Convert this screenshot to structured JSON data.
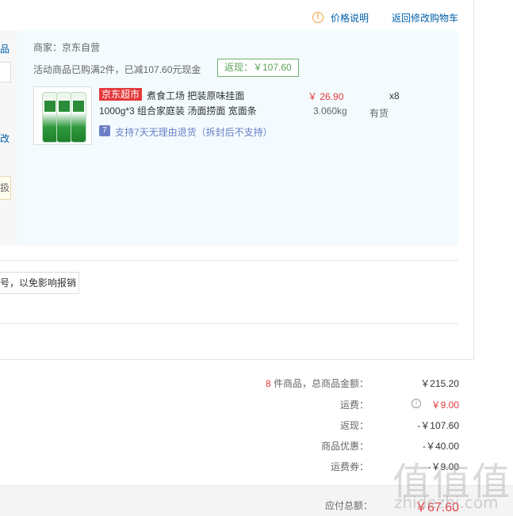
{
  "header": {
    "price_explain_label": "价格说明",
    "back_to_cart_label": "返回修改购物车",
    "info_icon": "info-circle-icon",
    "info_glyph": "!"
  },
  "left_fragments": {
    "top": "品",
    "middle": "改",
    "tip": "扱"
  },
  "shop": {
    "merchant": "商家：京东自营",
    "promo_text": "活动商品已购满2件，已减107.60元现金",
    "cashback_badge": "返现：￥107.60"
  },
  "product": {
    "tag": "京东超市",
    "name_line1": "煮食工场 把装原味挂面",
    "name_line2": "1000g*3 组合家庭装 汤面捞面 宽面条",
    "price": "￥ 26.90",
    "quantity": "x8",
    "weight": "3.060kg",
    "stock": "有货",
    "return_icon_glyph": "7",
    "return_policy": "支持7天无理由退货（拆封后不支持）"
  },
  "invoice": {
    "note": "号，以免影响报销"
  },
  "summary": {
    "items_count": "8",
    "items_label": " 件商品，总商品金额：",
    "items_amount": "￥215.20",
    "freight_label": "运费：",
    "freight_amount": "￥9.00",
    "freight_icon_glyph": "!",
    "cashback_label": "返现：",
    "cashback_amount": "-￥107.60",
    "discount_label": "商品优惠：",
    "discount_amount": "-￥40.00",
    "freight_coupon_label": "运费券：",
    "freight_coupon_amount": "-￥9.00",
    "payable_label": "应付总额：",
    "payable_amount": "￥67.60"
  },
  "watermark": {
    "glyphs": "值值值",
    "url": "zhidezhi.com"
  },
  "colors": {
    "link": "#005ea7",
    "price_red": "#e4393c",
    "panel_bg": "#f3fbfe",
    "cashback_green": "#5aa35a",
    "return_blue": "#6a7fc6"
  }
}
